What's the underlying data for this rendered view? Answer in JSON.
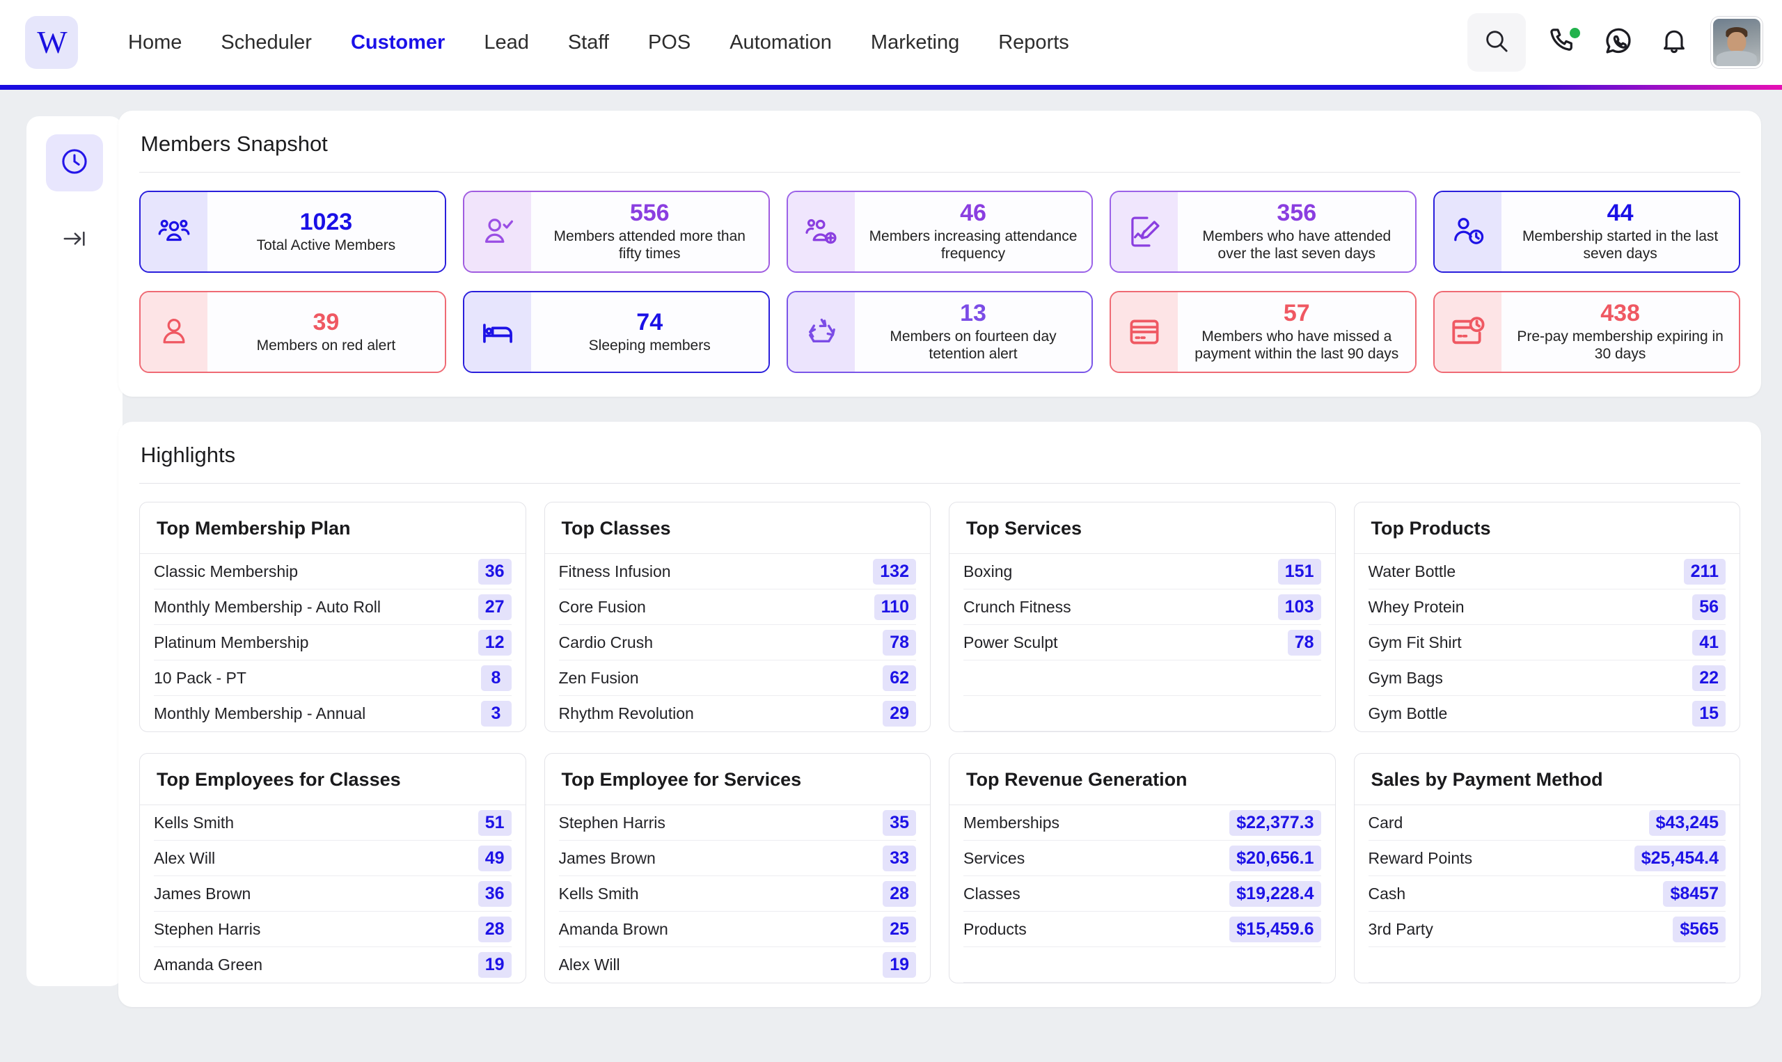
{
  "nav": {
    "logo": "W",
    "items": [
      {
        "label": "Home",
        "active": false
      },
      {
        "label": "Scheduler",
        "active": false
      },
      {
        "label": "Customer",
        "active": true
      },
      {
        "label": "Lead",
        "active": false
      },
      {
        "label": "Staff",
        "active": false
      },
      {
        "label": "POS",
        "active": false
      },
      {
        "label": "Automation",
        "active": false
      },
      {
        "label": "Marketing",
        "active": false
      },
      {
        "label": "Reports",
        "active": false
      }
    ],
    "icons": [
      "search-icon",
      "phone-icon",
      "whatsapp-icon",
      "bell-icon",
      "avatar"
    ]
  },
  "rail": {
    "items": [
      "clock-icon",
      "collapse-icon"
    ]
  },
  "snapshot": {
    "title": "Members Snapshot",
    "cards": [
      {
        "value": "1023",
        "label": "Total Active Members",
        "theme": "t-indigo",
        "icon": "group-members-icon"
      },
      {
        "value": "556",
        "label": "Members attended more than fifty times",
        "theme": "t-purple",
        "icon": "user-check-icon"
      },
      {
        "value": "46",
        "label": "Members increasing attendance frequency",
        "theme": "t-violet",
        "icon": "group-add-icon"
      },
      {
        "value": "356",
        "label": "Members who have attended over the last seven days",
        "theme": "t-violet",
        "icon": "document-edit-icon"
      },
      {
        "value": "44",
        "label": "Membership started in the last seven days",
        "theme": "t-indigo",
        "icon": "user-clock-icon"
      },
      {
        "value": "39",
        "label": "Members on red alert",
        "theme": "t-red",
        "icon": "user-icon"
      },
      {
        "value": "74",
        "label": "Sleeping members",
        "theme": "t-indigo",
        "icon": "bed-icon"
      },
      {
        "value": "13",
        "label": "Members on fourteen day tetention alert",
        "theme": "t-pviolet",
        "icon": "recycle-icon"
      },
      {
        "value": "57",
        "label": "Members who have missed a payment within the last 90 days",
        "theme": "t-red",
        "icon": "credit-card-icon"
      },
      {
        "value": "438",
        "label": "Pre-pay membership expiring in 30 days",
        "theme": "t-red",
        "icon": "card-clock-icon"
      }
    ]
  },
  "highlights": {
    "title": "Highlights",
    "cards": [
      {
        "title": "Top Membership Plan",
        "rows": [
          {
            "name": "Classic Membership",
            "value": "36"
          },
          {
            "name": "Monthly Membership - Auto Roll",
            "value": "27"
          },
          {
            "name": "Platinum Membership",
            "value": "12"
          },
          {
            "name": "10 Pack - PT",
            "value": "8"
          },
          {
            "name": "Monthly Membership - Annual",
            "value": "3"
          }
        ]
      },
      {
        "title": "Top Classes",
        "rows": [
          {
            "name": "Fitness Infusion",
            "value": "132"
          },
          {
            "name": "Core Fusion",
            "value": "110"
          },
          {
            "name": "Cardio Crush",
            "value": "78"
          },
          {
            "name": "Zen Fusion",
            "value": "62"
          },
          {
            "name": "Rhythm Revolution",
            "value": "29"
          }
        ]
      },
      {
        "title": "Top Services",
        "rows": [
          {
            "name": "Boxing",
            "value": "151"
          },
          {
            "name": "Crunch Fitness",
            "value": "103"
          },
          {
            "name": "Power Sculpt",
            "value": "78"
          },
          {
            "name": "",
            "value": ""
          },
          {
            "name": "",
            "value": ""
          }
        ]
      },
      {
        "title": "Top Products",
        "rows": [
          {
            "name": "Water Bottle",
            "value": "211"
          },
          {
            "name": "Whey Protein",
            "value": "56"
          },
          {
            "name": "Gym Fit Shirt",
            "value": "41"
          },
          {
            "name": "Gym Bags",
            "value": "22"
          },
          {
            "name": "Gym Bottle",
            "value": "15"
          }
        ]
      },
      {
        "title": "Top Employees for Classes",
        "rows": [
          {
            "name": "Kells Smith",
            "value": "51"
          },
          {
            "name": "Alex Will",
            "value": "49"
          },
          {
            "name": "James Brown",
            "value": "36"
          },
          {
            "name": "Stephen Harris",
            "value": "28"
          },
          {
            "name": "Amanda Green",
            "value": "19"
          }
        ]
      },
      {
        "title": "Top Employee for Services",
        "rows": [
          {
            "name": "Stephen Harris",
            "value": "35"
          },
          {
            "name": "James Brown",
            "value": "33"
          },
          {
            "name": "Kells Smith",
            "value": "28"
          },
          {
            "name": "Amanda Brown",
            "value": "25"
          },
          {
            "name": "Alex Will",
            "value": "19"
          }
        ]
      },
      {
        "title": "Top Revenue Generation",
        "rows": [
          {
            "name": "Memberships",
            "value": "$22,377.3"
          },
          {
            "name": "Services",
            "value": "$20,656.1"
          },
          {
            "name": "Classes",
            "value": "$19,228.4"
          },
          {
            "name": "Products",
            "value": "$15,459.6"
          },
          {
            "name": "",
            "value": ""
          }
        ]
      },
      {
        "title": "Sales by Payment Method",
        "rows": [
          {
            "name": "Card",
            "value": "$43,245"
          },
          {
            "name": "Reward Points",
            "value": "$25,454.4"
          },
          {
            "name": "Cash",
            "value": "$8457"
          },
          {
            "name": "3rd Party",
            "value": "$565"
          },
          {
            "name": "",
            "value": ""
          }
        ]
      }
    ]
  },
  "colors": {
    "brand_indigo": "#1a10e6",
    "accent_purple": "#8a3ee0",
    "accent_red": "#ef5862",
    "value_chip_bg": "#e4e2fb"
  }
}
